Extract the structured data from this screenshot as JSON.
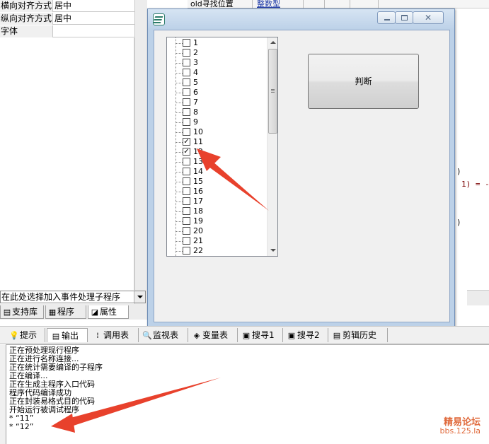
{
  "properties": [
    {
      "key": "横向对齐方式",
      "value": "居中"
    },
    {
      "key": "纵向对齐方式",
      "value": "居中"
    },
    {
      "key": "字体",
      "value": ""
    }
  ],
  "event_select": {
    "value": "在此处选择加入事件处理子程序"
  },
  "left_tabs": [
    {
      "label": "支持库",
      "icon": "book-icon"
    },
    {
      "label": "程序",
      "icon": "program-icon"
    },
    {
      "label": "属性",
      "icon": "property-icon",
      "active": true
    }
  ],
  "code": {
    "header_cells": [
      "old寻找位置",
      "整数型"
    ],
    "fragments": [
      ")",
      "1) = -",
      ")"
    ]
  },
  "dialog": {
    "icon": "app-logo-icon",
    "button_label": "判断",
    "tree_items": [
      {
        "label": "1",
        "checked": false
      },
      {
        "label": "2",
        "checked": false
      },
      {
        "label": "3",
        "checked": false
      },
      {
        "label": "4",
        "checked": false
      },
      {
        "label": "5",
        "checked": false
      },
      {
        "label": "6",
        "checked": false
      },
      {
        "label": "7",
        "checked": false
      },
      {
        "label": "8",
        "checked": false
      },
      {
        "label": "9",
        "checked": false
      },
      {
        "label": "10",
        "checked": false
      },
      {
        "label": "11",
        "checked": true
      },
      {
        "label": "12",
        "checked": true
      },
      {
        "label": "13",
        "checked": false
      },
      {
        "label": "14",
        "checked": false
      },
      {
        "label": "15",
        "checked": false
      },
      {
        "label": "16",
        "checked": false
      },
      {
        "label": "17",
        "checked": false
      },
      {
        "label": "18",
        "checked": false
      },
      {
        "label": "19",
        "checked": false
      },
      {
        "label": "20",
        "checked": false
      },
      {
        "label": "21",
        "checked": false
      },
      {
        "label": "22",
        "checked": false
      }
    ]
  },
  "output_tabs": [
    {
      "label": "提示",
      "icon": "lightbulb-icon"
    },
    {
      "label": "输出",
      "icon": "output-icon",
      "active": true
    },
    {
      "label": "调用表",
      "icon": "call-table-icon"
    },
    {
      "label": "监视表",
      "icon": "magnifier-icon"
    },
    {
      "label": "变量表",
      "icon": "variable-icon"
    },
    {
      "label": "搜寻1",
      "icon": "search-icon"
    },
    {
      "label": "搜寻2",
      "icon": "search-icon"
    },
    {
      "label": "剪辑历史",
      "icon": "clipboard-icon"
    }
  ],
  "output_lines": [
    "正在预处理现行程序",
    "正在进行名称连接...",
    "正在统计需要编译的子程序",
    "正在编译...",
    "正在生成主程序入口代码",
    "程序代码编译成功",
    "正在封装易格式目的代码",
    "开始运行被调试程序",
    "* “11”",
    "* “12”"
  ],
  "watermark": {
    "name": "精易论坛",
    "url": "bbs.125.la"
  },
  "annotation_color": "#e8412c"
}
